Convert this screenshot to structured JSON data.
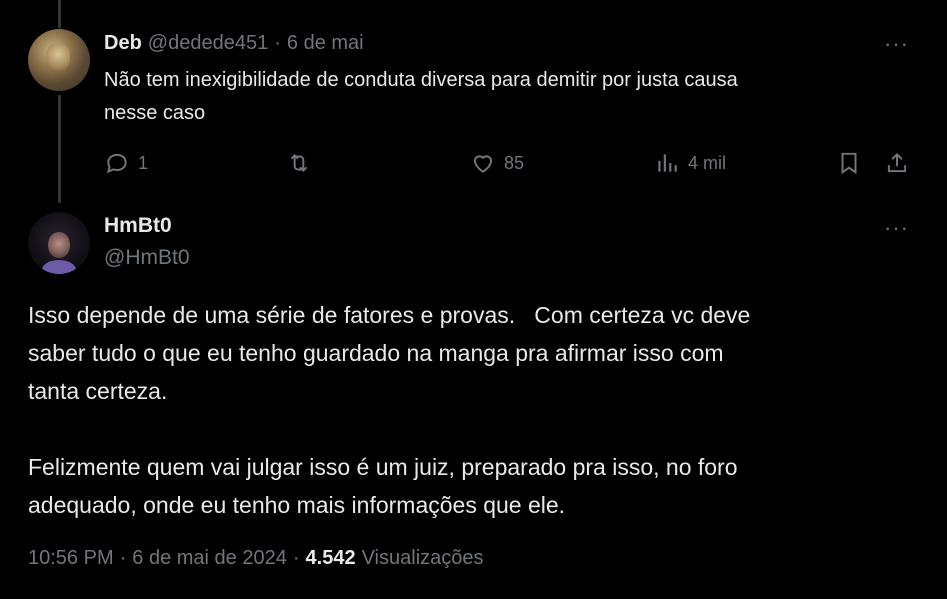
{
  "reply": {
    "author_name": "Deb",
    "author_handle": "@dedede451",
    "separator": "·",
    "date": "6 de mai",
    "text_line1": "Não tem inexigibilidade de conduta diversa para demitir por justa causa",
    "text_line2": "nesse caso",
    "actions": {
      "reply_count": "1",
      "retweet_count": "",
      "like_count": "85",
      "views_count": "4 mil"
    }
  },
  "main": {
    "author_name": "HmBt0",
    "author_handle": "@HmBt0",
    "paragraph1_line1": "Isso depende de uma série de fatores e provas.   Com certeza vc deve",
    "paragraph1_line2": "saber tudo o que eu tenho guardado na manga pra afirmar isso com",
    "paragraph1_line3": "tanta certeza.",
    "paragraph2_line1": "Felizmente quem vai julgar isso é um juiz, preparado pra isso, no foro",
    "paragraph2_line2": "adequado, onde eu tenho mais informações que ele.",
    "time": "10:56 PM",
    "sep1": "·",
    "full_date": "6 de mai de 2024",
    "sep2": "·",
    "views_number": "4.542",
    "views_label": "Visualizações"
  },
  "icons": {
    "more": "more-horizontal-icon",
    "reply": "reply-bubble-icon",
    "retweet": "retweet-icon",
    "like": "heart-icon",
    "views": "views-bar-chart-icon",
    "bookmark": "bookmark-icon",
    "share": "share-icon"
  },
  "colors": {
    "background": "#000000",
    "text": "#e7e9ea",
    "muted": "#71767b",
    "thread_line": "#333639"
  }
}
